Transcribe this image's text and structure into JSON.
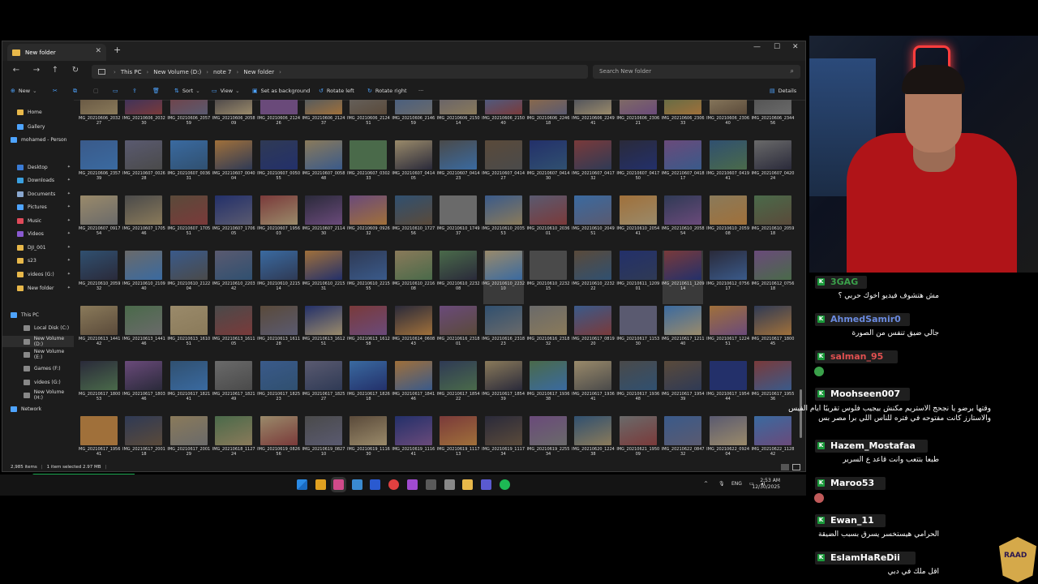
{
  "window": {
    "tab_title": "New folder",
    "breadcrumbs": [
      "This PC",
      "New Volume (D:)",
      "note 7",
      "New folder"
    ],
    "search_placeholder": "Search New folder",
    "toolbar": {
      "new": "New",
      "sort": "Sort",
      "view": "View",
      "set_background": "Set as background",
      "rotate_left": "Rotate left",
      "rotate_right": "Rotate right",
      "more": "···",
      "details": "Details"
    },
    "status": {
      "count": "2,985 items",
      "selected": "1 item selected  2.97 MB"
    }
  },
  "sidebar": {
    "items": [
      {
        "label": "Home",
        "icon": "home-icon",
        "color": "#e8b84a"
      },
      {
        "label": "Gallery",
        "icon": "gallery-icon",
        "color": "#4ea4ff"
      },
      {
        "label": "mohamed - Person",
        "icon": "cloud-icon",
        "color": "#4ea4ff"
      },
      {
        "label": "Desktop",
        "icon": "desktop-icon",
        "color": "#3a7bd5"
      },
      {
        "label": "Downloads",
        "icon": "download-icon",
        "color": "#3aa0e0"
      },
      {
        "label": "Documents",
        "icon": "documents-icon",
        "color": "#8aa8d0"
      },
      {
        "label": "Pictures",
        "icon": "pictures-icon",
        "color": "#4ea4ff"
      },
      {
        "label": "Music",
        "icon": "music-icon",
        "color": "#e04a5a"
      },
      {
        "label": "Videos",
        "icon": "videos-icon",
        "color": "#8a5ad0"
      },
      {
        "label": "DJI_001",
        "icon": "folder-icon",
        "color": "#e8b84a"
      },
      {
        "label": "s23",
        "icon": "folder-icon",
        "color": "#e8b84a"
      },
      {
        "label": "videos (G:)",
        "icon": "folder-icon",
        "color": "#e8b84a"
      },
      {
        "label": "New folder",
        "icon": "folder-icon",
        "color": "#e8b84a"
      },
      {
        "label": "This PC",
        "icon": "pc-icon",
        "color": "#4ea4ff"
      },
      {
        "label": "Local Disk (C:)",
        "icon": "drive-icon",
        "color": "#888888"
      },
      {
        "label": "New Volume (D:)",
        "icon": "drive-icon",
        "color": "#888888"
      },
      {
        "label": "New Volume (E:)",
        "icon": "drive-icon",
        "color": "#888888"
      },
      {
        "label": "Games (F:)",
        "icon": "drive-icon",
        "color": "#888888"
      },
      {
        "label": "videos (G:)",
        "icon": "drive-icon",
        "color": "#888888"
      },
      {
        "label": "New Volume (H:)",
        "icon": "drive-icon",
        "color": "#888888"
      },
      {
        "label": "Network",
        "icon": "network-icon",
        "color": "#4ea4ff"
      }
    ]
  },
  "files": [
    [
      "IMG_20210606_203227",
      "IMG_20210606_203230",
      "IMG_20210606_205759",
      "IMG_20210606_205809",
      "IMG_20210606_212426",
      "IMG_20210606_212437",
      "IMG_20210606_212451",
      "IMG_20210606_214659",
      "IMG_20210606_215014",
      "IMG_20210606_215040",
      "IMG_20210606_224618",
      "IMG_20210606_224941",
      "IMG_20210606_230621",
      "IMG_20210606_230633",
      "IMG_20210606_230640",
      "IMG_20210606_234456"
    ],
    [
      "IMG_20210606_235739",
      "IMG_20210607_002628",
      "IMG_20210607_003631",
      "IMG_20210607_004004",
      "IMG_20210607_005055",
      "IMG_20210607_005848",
      "IMG_20210607_030233",
      "IMG_20210607_041405",
      "IMG_20210607_041423",
      "IMG_20210607_041427",
      "IMG_20210607_041430",
      "IMG_20210607_041732",
      "IMG_20210607_041750",
      "IMG_20210607_041817",
      "IMG_20210607_041941",
      "IMG_20210607_042024"
    ],
    [
      "IMG_20210607_091754",
      "IMG_20210607_170546",
      "IMG_20210607_170551",
      "IMG_20210607_170605",
      "IMG_20210607_195603",
      "IMG_20210607_211430",
      "IMG_20210609_092632",
      "IMG_20210610_172756",
      "IMG_20210610_174937",
      "IMG_20210610_203553",
      "IMG_20210610_203601",
      "IMG_20210610_204951",
      "IMG_20210610_205441",
      "IMG_20210610_205854",
      "IMG_20210610_205908",
      "IMG_20210610_205918"
    ],
    [
      "IMG_20210610_205932",
      "IMG_20210610_210940",
      "IMG_20210610_212204",
      "IMG_20210610_220342",
      "IMG_20210610_221514",
      "IMG_20210610_221531",
      "IMG_20210610_221555",
      "IMG_20210610_221608",
      "IMG_20210610_223208",
      "IMG_20210610_223210",
      "IMG_20210610_223215",
      "IMG_20210610_223222",
      "IMG_20210611_120901",
      "IMG_20210611_120914",
      "IMG_20210612_075617",
      "IMG_20210612_075618"
    ],
    [
      "IMG_20210613_144142",
      "IMG_20210613_144146",
      "IMG_20210613_161051",
      "IMG_20210613_161105",
      "IMG_20210613_161128",
      "IMG_20210613_161251",
      "IMG_20210613_161258",
      "IMG_20210614_060843",
      "IMG_20210616_231801",
      "IMG_20210616_231823",
      "IMG_20210616_231832",
      "IMG_20210617_081920",
      "IMG_20210617_115330",
      "IMG_20210617_121140",
      "IMG_20210617_122451",
      "IMG_20210617_180045"
    ],
    [
      "IMG_20210617_180053",
      "IMG_20210617_180346",
      "IMG_20210617_182141",
      "IMG_20210617_182149",
      "IMG_20210617_182523",
      "IMG_20210617_182527",
      "IMG_20210617_182618",
      "IMG_20210617_184146",
      "IMG_20210617_185422",
      "IMG_20210617_185439",
      "IMG_20210617_193638",
      "IMG_20210617_193641",
      "IMG_20210617_193648",
      "IMG_20210617_195439",
      "IMG_20210617_195444",
      "IMG_20210617_195536"
    ],
    [
      "IMG_20210617_195641",
      "IMG_20210617_200118",
      "IMG_20210617_200129",
      "IMG_20210618_112724",
      "IMG_20210619_082656",
      "IMG_20210619_082710",
      "IMG_20210619_111630",
      "IMG_20210619_111641",
      "IMG_20210619_111713",
      "IMG_20210619_111734",
      "IMG_20210619_225534",
      "IMG_20210620_122438",
      "IMG_20210621_195009",
      "IMG_20210622_084732",
      "IMG_20210622_092404",
      "IMG_20210622_112842"
    ]
  ],
  "thumb_colors": [
    "#5a4a3a",
    "#2f3a55",
    "#6a6a6a",
    "#23306a",
    "#8a7a5a",
    "#3a5a8a",
    "#7a3a3a",
    "#4a6a4a",
    "#5a5a70",
    "#2a2a3a",
    "#9a8a6a",
    "#3a6aa0",
    "#6a4a7a",
    "#4a4a4a",
    "#a0703a",
    "#305070"
  ],
  "taskbar": {
    "lang": "ENG",
    "time": "2:53 AM",
    "date": "12/30/2025",
    "icon_colors": [
      "#2a7bd5",
      "#e0a020",
      "#d04a8a",
      "#3a8ad0",
      "#2a5ad0",
      "#e04040",
      "#a04ad0",
      "#5a5a5a",
      "#888888",
      "#e8b84a",
      "#5a5ad0",
      "#1db954"
    ]
  },
  "chat": {
    "messages": [
      {
        "user": "3GAG",
        "color": "#3aa04a",
        "text": "مش هتشوف فيديو اخوك حربي ؟"
      },
      {
        "user": "AhmedSamir0",
        "color": "#6a8adf",
        "text": "جالي ضيق تنفس من الصورة"
      },
      {
        "user": "salman_95",
        "color": "#e05050",
        "text": ""
      },
      {
        "user": "Moohseen007",
        "color": "#ffffff",
        "text": "وقتها برضو يا نجحج الاستريم مكنش بيجيب فلوس تقريبًا ايام الفيس والاستارز كانت مفتوحه في فتره للناس اللي برا مصر بس"
      },
      {
        "user": "Hazem_Mostafaa",
        "color": "#ffffff",
        "text": "طبعا بتتعب وانت قاعد ع السرير"
      },
      {
        "user": "Maroo53",
        "color": "#ffffff",
        "text": ""
      },
      {
        "user": "Ewan_11",
        "color": "#ffffff",
        "text": "الحرامي هيستخسر يسرق بسبب الضيقة"
      },
      {
        "user": "EslamHaReDii",
        "color": "#ffffff",
        "text": "اقل ملك في دبي"
      }
    ],
    "crest_text": "RAAD"
  }
}
